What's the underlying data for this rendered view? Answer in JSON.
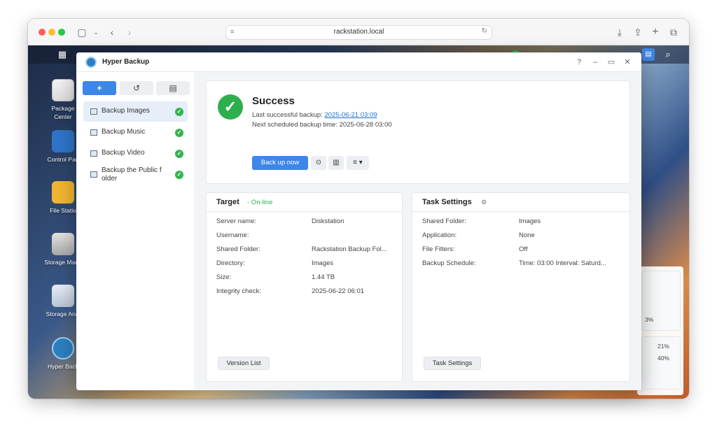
{
  "browser": {
    "url": "rackstation.local"
  },
  "desktop": {
    "icons": [
      {
        "label_line1": "Package",
        "label_line2": "Center",
        "icon": "package-center-icon"
      },
      {
        "label_line1": "Control Pan",
        "label_line2": "",
        "icon": "control-panel-icon"
      },
      {
        "label_line1": "File Statio",
        "label_line2": "",
        "icon": "file-station-icon"
      },
      {
        "label_line1": "Storage Mana",
        "label_line2": "",
        "icon": "storage-manager-icon"
      },
      {
        "label_line1": "Storage Anal",
        "label_line2": "",
        "icon": "storage-analyzer-icon"
      },
      {
        "label_line1": "Hyper Back",
        "label_line2": "",
        "icon": "hyper-backup-icon"
      }
    ],
    "widget": {
      "value1": "3%",
      "value2": "21%",
      "value3": "40%"
    }
  },
  "window": {
    "title": "Hyper Backup",
    "controls": {
      "help": "?",
      "minimize": "–",
      "maximize": "▭",
      "close": "✕"
    }
  },
  "sidebar": {
    "buttons": {
      "add": "+",
      "restore": "↺",
      "log": "▤"
    },
    "tasks": [
      {
        "name": "Backup Images",
        "status": "ok"
      },
      {
        "name": "Backup Music",
        "status": "ok"
      },
      {
        "name": "Backup Video",
        "status": "ok"
      },
      {
        "name": "Backup the Public f older",
        "status": "ok"
      }
    ]
  },
  "status": {
    "title": "Success",
    "last_label": "Last successful backup:",
    "last_value": "2025-06-21 03:09",
    "next_text": "Next scheduled backup time: 2025-06-28 03:00",
    "backup_now": "Back up now"
  },
  "target": {
    "title": "Target",
    "status": "- On-line",
    "rows": [
      {
        "label": "Server name:",
        "value": "Diskstation"
      },
      {
        "label": "Username:",
        "value": ""
      },
      {
        "label": "Shared Folder:",
        "value": "Rackstation Backup Fol..."
      },
      {
        "label": "Directory:",
        "value": "Images"
      },
      {
        "label": "Size:",
        "value": "1.44 TB"
      },
      {
        "label": "Integrity check:",
        "value": "2025-06-22 06:01"
      }
    ],
    "button": "Version List"
  },
  "settings": {
    "title": "Task Settings",
    "rows": [
      {
        "label": "Shared Folder:",
        "value": "Images"
      },
      {
        "label": "Application:",
        "value": "None"
      },
      {
        "label": "File Filters:",
        "value": "Off"
      },
      {
        "label": "Backup Schedule:",
        "value": "Time: 03:00 Interval: Saturd..."
      }
    ],
    "button": "Task Settings"
  },
  "colors": {
    "accent": "#3d87e8",
    "success": "#2eaf4d",
    "link": "#1a73c9"
  }
}
